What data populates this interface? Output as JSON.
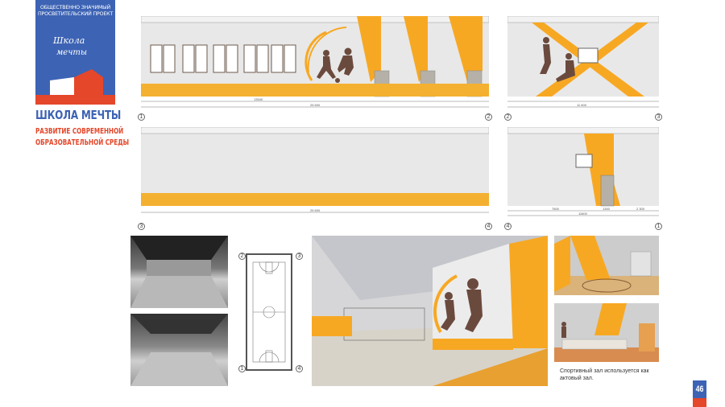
{
  "logo": {
    "line1": "ОБЩЕСТВЕННО ЗНАЧИМЫЙ",
    "line2": "ПРОСВЕТИТЕЛЬСКИЙ ПРОЕКТ",
    "script1": "Школа",
    "script2": "мечты"
  },
  "brand": {
    "title": "ШКОЛА МЕЧТЫ",
    "subtitle1": "РАЗВИТИЕ СОВРЕМЕННОЙ",
    "subtitle2": "ОБРАЗОВАТЕЛЬНОЙ СРЕДЫ"
  },
  "colors": {
    "blue": "#3d63b4",
    "red": "#e4472a",
    "orange": "#f7a823",
    "wall": "#e6e6e6",
    "figure": "#6b4a3e"
  },
  "elevations": [
    {
      "axis_left": "1",
      "axis_right": "2",
      "total": "25 600",
      "dim": "13540"
    },
    {
      "axis_left": "2",
      "axis_right": "3",
      "total": "11 600"
    },
    {
      "axis_left": "3",
      "axis_right": "4",
      "total": "25 600"
    },
    {
      "axis_left": "4",
      "axis_right": "1",
      "total": "11600",
      "dims": [
        "7600",
        "1300",
        "2 300"
      ]
    }
  ],
  "plan": {
    "axis_tl": "2",
    "axis_tr": "3",
    "axis_bl": "1",
    "axis_br": "4"
  },
  "caption": "Спортивный зал используется как актовый зал.",
  "page_number": "46"
}
